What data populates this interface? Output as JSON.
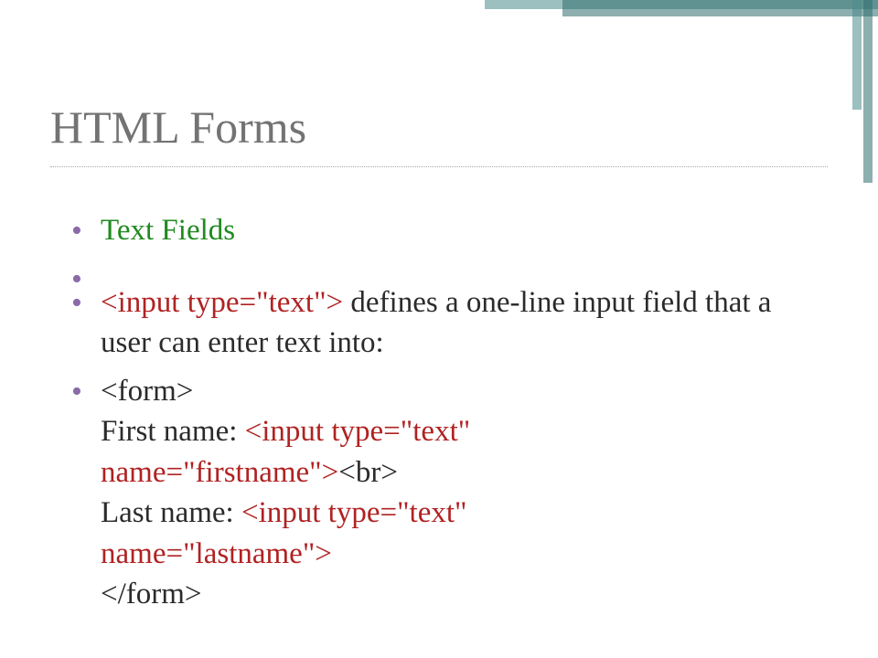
{
  "title": "HTML Forms",
  "bullets": [
    {
      "text": "Text Fields"
    },
    {
      "code": "<input type=\"text\">",
      "text": " defines a one-line input field that a user can enter text into:"
    },
    {
      "line1_a": "<form>",
      "line2_a": "First name: ",
      "line2_b": "<input type=\"text\" ",
      "line3_a": "name=\"firstname\">",
      "line3_b": "<br>",
      "line4_a": "Last name: ",
      "line4_b": "<input type=\"text\" ",
      "line5_a": "name=\"lastname\">",
      "line6_a": "</form>"
    }
  ]
}
